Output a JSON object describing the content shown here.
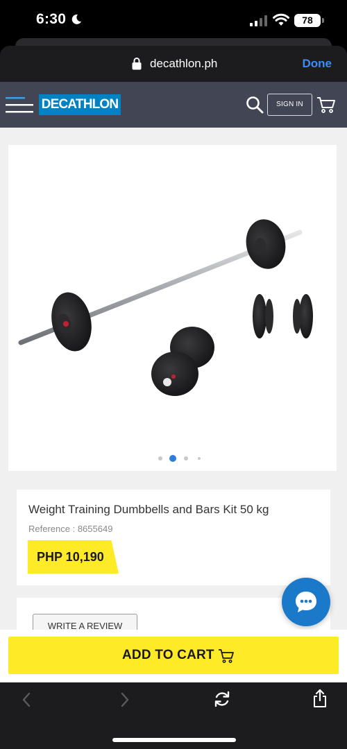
{
  "status_bar": {
    "time": "6:30",
    "battery": "78"
  },
  "browser": {
    "url": "decathlon.ph",
    "done_label": "Done"
  },
  "header": {
    "logo_text": "DECATHLON",
    "signin_label": "SIGN IN"
  },
  "gallery": {
    "image_count": 4,
    "active_index": 1
  },
  "product": {
    "title": "Weight Training Dumbbells and Bars Kit 50 kg",
    "reference": "Reference : 8655649",
    "price": "PHP 10,190"
  },
  "review": {
    "button_label": "WRITE A REVIEW"
  },
  "cart": {
    "button_label": "ADD TO CART"
  },
  "colors": {
    "brand_blue": "#0082c3",
    "price_yellow": "#ffea28",
    "header_gray": "#424553",
    "safari_blue": "#3a8ef6"
  }
}
